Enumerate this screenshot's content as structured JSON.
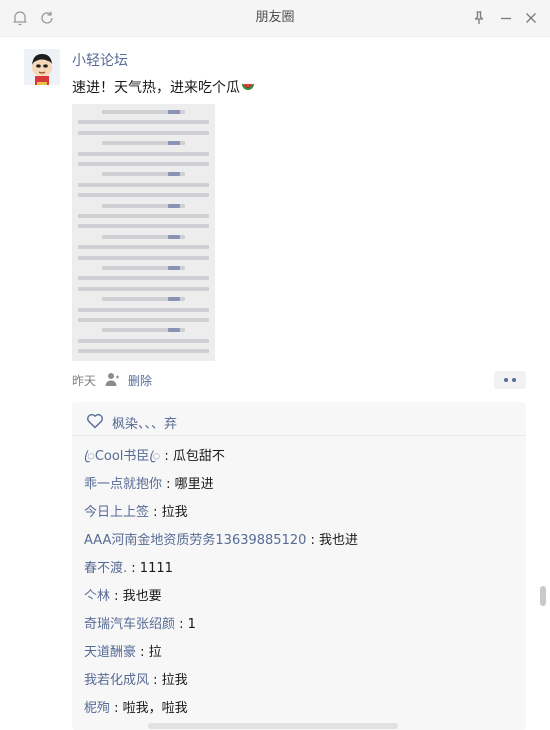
{
  "window": {
    "title": "朋友圈"
  },
  "post": {
    "author": "小轻论坛",
    "text": "速进！天气热，进来吃个瓜",
    "time": "昨天",
    "delete_label": "删除"
  },
  "likes": {
    "text": "枫染、、、弃"
  },
  "comments": [
    {
      "name": "ꦿCool书臣ꦿ",
      "text": "瓜包甜不"
    },
    {
      "name": "乖一点就抱你",
      "text": "哪里进"
    },
    {
      "name": "今日上上签",
      "text": "拉我"
    },
    {
      "name": "AAA河南金地资质劳务13639885120",
      "text": "我也进"
    },
    {
      "name": "春不渡.",
      "text": "1111"
    },
    {
      "name": "亽林",
      "text": "我也要"
    },
    {
      "name": "奇瑞汽车张绍颜",
      "text": "1"
    },
    {
      "name": "天道酬豪",
      "text": "拉"
    },
    {
      "name": "我若化成风",
      "text": "拉我"
    },
    {
      "name": "柅殉",
      "text": "啦我，啦我"
    }
  ],
  "colors": {
    "link": "#576b95",
    "text": "#191919",
    "muted": "#7f7f7f",
    "panel": "#f7f7f7"
  },
  "icons": [
    "bell-icon",
    "refresh-icon",
    "pin-icon",
    "minimize-icon",
    "close-icon",
    "person-icon",
    "heart-icon",
    "more-icon",
    "watermelon-icon"
  ]
}
